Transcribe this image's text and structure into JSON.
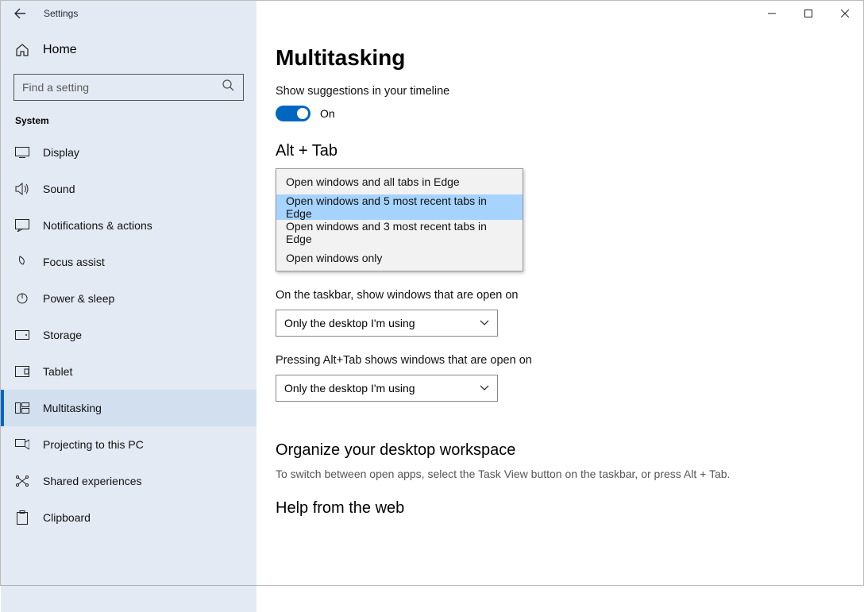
{
  "titlebar": {
    "title": "Settings"
  },
  "sidebar": {
    "home": "Home",
    "search_ph": "Find a setting",
    "section": "System",
    "items": [
      {
        "label": "Display"
      },
      {
        "label": "Sound"
      },
      {
        "label": "Notifications & actions"
      },
      {
        "label": "Focus assist"
      },
      {
        "label": "Power & sleep"
      },
      {
        "label": "Storage"
      },
      {
        "label": "Tablet"
      },
      {
        "label": "Multitasking"
      },
      {
        "label": "Projecting to this PC"
      },
      {
        "label": "Shared experiences"
      },
      {
        "label": "Clipboard"
      }
    ]
  },
  "main": {
    "title": "Multitasking",
    "timeline_label": "Show suggestions in your timeline",
    "timeline_state": "On",
    "alt_tab_heading": "Alt + Tab",
    "alt_tab_options": [
      "Open windows and all tabs in Edge",
      "Open windows and 5 most recent tabs in Edge",
      "Open windows and 3 most recent tabs in Edge",
      "Open windows only"
    ],
    "taskbar_label": "On the taskbar, show windows that are open on",
    "taskbar_value": "Only the desktop I'm using",
    "alttab_label": "Pressing Alt+Tab shows windows that are open on",
    "alttab_value": "Only the desktop I'm using",
    "organize_heading": "Organize your desktop workspace",
    "organize_desc": "To switch between open apps, select the Task View button on the taskbar, or press Alt + Tab.",
    "help_heading": "Help from the web"
  }
}
